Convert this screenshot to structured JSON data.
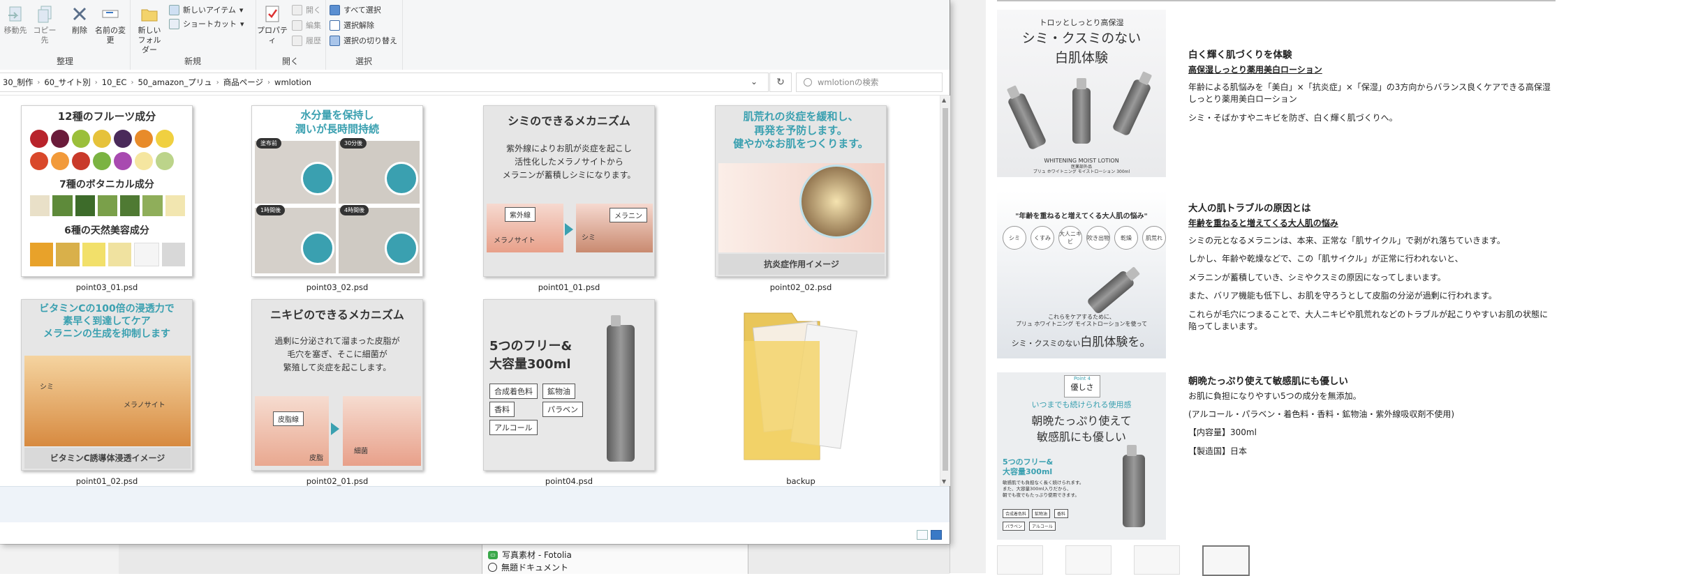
{
  "ribbon": {
    "groups": [
      {
        "title": "整理",
        "buttons": [
          "移動先",
          "コピー先",
          "削除",
          "名前の変更"
        ]
      },
      {
        "title": "新規",
        "buttons": [
          "新しいフォルダー"
        ],
        "small": [
          "新しいアイテム",
          "ショートカット"
        ]
      },
      {
        "title": "開く",
        "buttons": [
          "プロパティ"
        ],
        "small": [
          "開く",
          "編集",
          "履歴"
        ]
      },
      {
        "title": "選択",
        "small": [
          "すべて選択",
          "選択解除",
          "選択の切り替え"
        ]
      }
    ]
  },
  "address": {
    "crumbs": [
      "30_制作",
      "60_サイト別",
      "10_EC",
      "50_amazon_プリュ",
      "商品ページ",
      "wmlotion"
    ],
    "search_placeholder": "wmlotionの検索"
  },
  "files": [
    {
      "name": "point03_01.psd",
      "title1": "12種のフルーツ成分",
      "title2": "7種のボタニカル成分",
      "title3": "6種の天然美容成分"
    },
    {
      "name": "point03_02.psd",
      "title": "水分量を保持し\n潤いが長時間持続",
      "labels": [
        "塗布前",
        "30分後",
        "1時間後",
        "4時間後"
      ]
    },
    {
      "name": "point01_01.psd",
      "title": "シミのできるメカニズム",
      "body": "紫外線によりお肌が炎症を起こし\n活性化したメラノサイトから\nメラニンが蓄積しシミになります。",
      "labels": [
        "紫外線",
        "メラノサイト",
        "シミ",
        "メラニン"
      ]
    },
    {
      "name": "point02_02.psd",
      "title": "肌荒れの炎症を緩和し、\n再発を予防します。\n健やかなお肌をつくります。",
      "caption": "抗炎症作用イメージ"
    },
    {
      "name": "point01_02.psd",
      "title": "ビタミンCの100倍の浸透力で\n素早く到達してケア\nメラニンの生成を抑制します",
      "labels": [
        "シミ",
        "メラノサイト"
      ],
      "caption": "ビタミンC誘導体浸透イメージ"
    },
    {
      "name": "point02_01.psd",
      "title": "ニキビのできるメカニズム",
      "body": "過剰に分泌されて溜まった皮脂が\n毛穴を塞ぎ、そこに細菌が\n繁殖して炎症を起こします。",
      "labels": [
        "皮脂線",
        "皮脂",
        "細菌"
      ]
    },
    {
      "name": "point04.psd",
      "title": "5つのフリー&\n大容量300ml",
      "chips": [
        "合成着色料",
        "鉱物油",
        "香料",
        "パラベン",
        "アルコール"
      ]
    },
    {
      "name": "backup"
    }
  ],
  "under_window": {
    "tree_items": [
      "写真素材 - Fotolia",
      "無題ドキュメント"
    ]
  },
  "web": {
    "sections": [
      {
        "img_small": "トロッとしっとり高保湿",
        "img_title": "シミ・クスミのない\n白肌体験",
        "img_product": "WHITENING MOIST LOTION",
        "img_product_sub": "医薬部外品\nプリュ ホワイトニング モイストローション 300ml",
        "heading": "白く輝く肌づくりを体験",
        "sub": "高保湿しっとり薬用美白ローション",
        "paras": [
          "年齢による肌悩みを「美白」×「抗炎症」×「保湿」の3方向からバランス良くケアできる高保湿しっとり薬用美白ローション",
          "シミ・そばかすやニキビを防ぎ、白く輝く肌づくりへ。"
        ]
      },
      {
        "img_title": "\"年齢を重ねると増えてくる大人肌の悩み\"",
        "img_circles": [
          "シミ",
          "くすみ",
          "大人ニキビ",
          "吹き出物",
          "乾燥",
          "肌荒れ"
        ],
        "img_mid": "これらをケアするために、\nプリュ ホワイトニング モイストローションを使って",
        "img_foot_pre": "シミ・クスミのない",
        "img_foot": "白肌体験を。",
        "heading": "大人の肌トラブルの原因とは",
        "sub": "年齢を重ねると増えてくる大人肌の悩み",
        "paras": [
          "シミの元となるメラニンは、本来、正常な「肌サイクル」で剥がれ落ちていきます。",
          "しかし、年齢や乾燥などで、この「肌サイクル」が正常に行われないと、",
          "メラニンが蓄積していき、シミやクスミの原因になってしまいます。",
          "また、バリア機能も低下し、お肌を守ろうとして皮脂の分泌が過剰に行われます。",
          "これらが毛穴につまることで、大人ニキビや肌荒れなどのトラブルが起こりやすいお肌の状態に陥ってしまいます。"
        ]
      },
      {
        "img_badge_small": "Point 4",
        "img_badge": "優しさ",
        "img_teal": "いつまでも続けられる使用感",
        "img_title": "朝晩たっぷり使えて\n敏感肌にも優しい",
        "img_free": "5つのフリー&\n大容量300ml",
        "img_note": "敏感肌でも負担なく長く続けられます。\nまた、大容量300ml入りだから、\n朝でも夜でもたっぷり使用できます。",
        "img_chips": [
          "合成着色料",
          "鉱物油",
          "香料",
          "パラベン",
          "アルコール"
        ],
        "heading": "朝晩たっぷり使えて敏感肌にも優しい",
        "paras": [
          "お肌に負担になりやすい5つの成分を無添加。",
          "(アルコール・パラベン・着色料・香料・鉱物油・紫外線吸収剤不使用)",
          "【内容量】300ml",
          "【製造国】日本"
        ]
      }
    ]
  }
}
